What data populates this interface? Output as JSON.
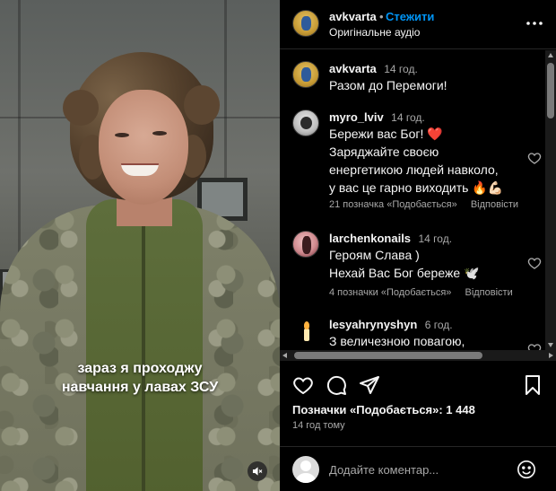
{
  "video": {
    "caption_line1": "зараз я проходжу",
    "caption_line2": "навчання у лавах ЗСУ",
    "mute_icon": "speaker-muted-icon"
  },
  "header": {
    "username": "avkvarta",
    "separator": "•",
    "follow_label": "Стежити",
    "audio_label": "Оригінальне аудіо",
    "more_icon": "more-horizontal-icon"
  },
  "comments": [
    {
      "user": "avkvarta",
      "time": "14 год.",
      "lines": [
        "Разом до Перемоги!"
      ]
    },
    {
      "user": "myro_lviv",
      "time": "14 год.",
      "lines": [
        "Бережи вас Бог! ❤️",
        "Заряджайте своєю",
        "енергетикою людей навколо,",
        "у вас це гарно виходить 🔥💪🏻"
      ],
      "likes": "21 позначка «Подобається»",
      "reply": "Відповісти"
    },
    {
      "user": "larchenkonails",
      "time": "14 год.",
      "lines": [
        "Героям Слава )",
        "Нехай Вас Бог береже 🕊️"
      ],
      "likes": "4 позначки «Подобається»",
      "reply": "Відповісти"
    },
    {
      "user": "lesyahrynyshyn",
      "time": "6 год.",
      "lines": [
        "З величезною повагою,"
      ]
    }
  ],
  "actions": {
    "like_icon": "heart-icon",
    "comment_icon": "comment-icon",
    "share_icon": "share-icon",
    "save_icon": "bookmark-icon",
    "likes_text": "Позначки «Подобається»: 1 448",
    "time_ago": "14 год тому"
  },
  "add_comment": {
    "placeholder": "Додайте коментар...",
    "emoji_icon": "emoji-icon"
  },
  "colors": {
    "background": "#000000",
    "link": "#0095f6",
    "muted": "#a8a8a8",
    "text": "#f5f5f5"
  }
}
